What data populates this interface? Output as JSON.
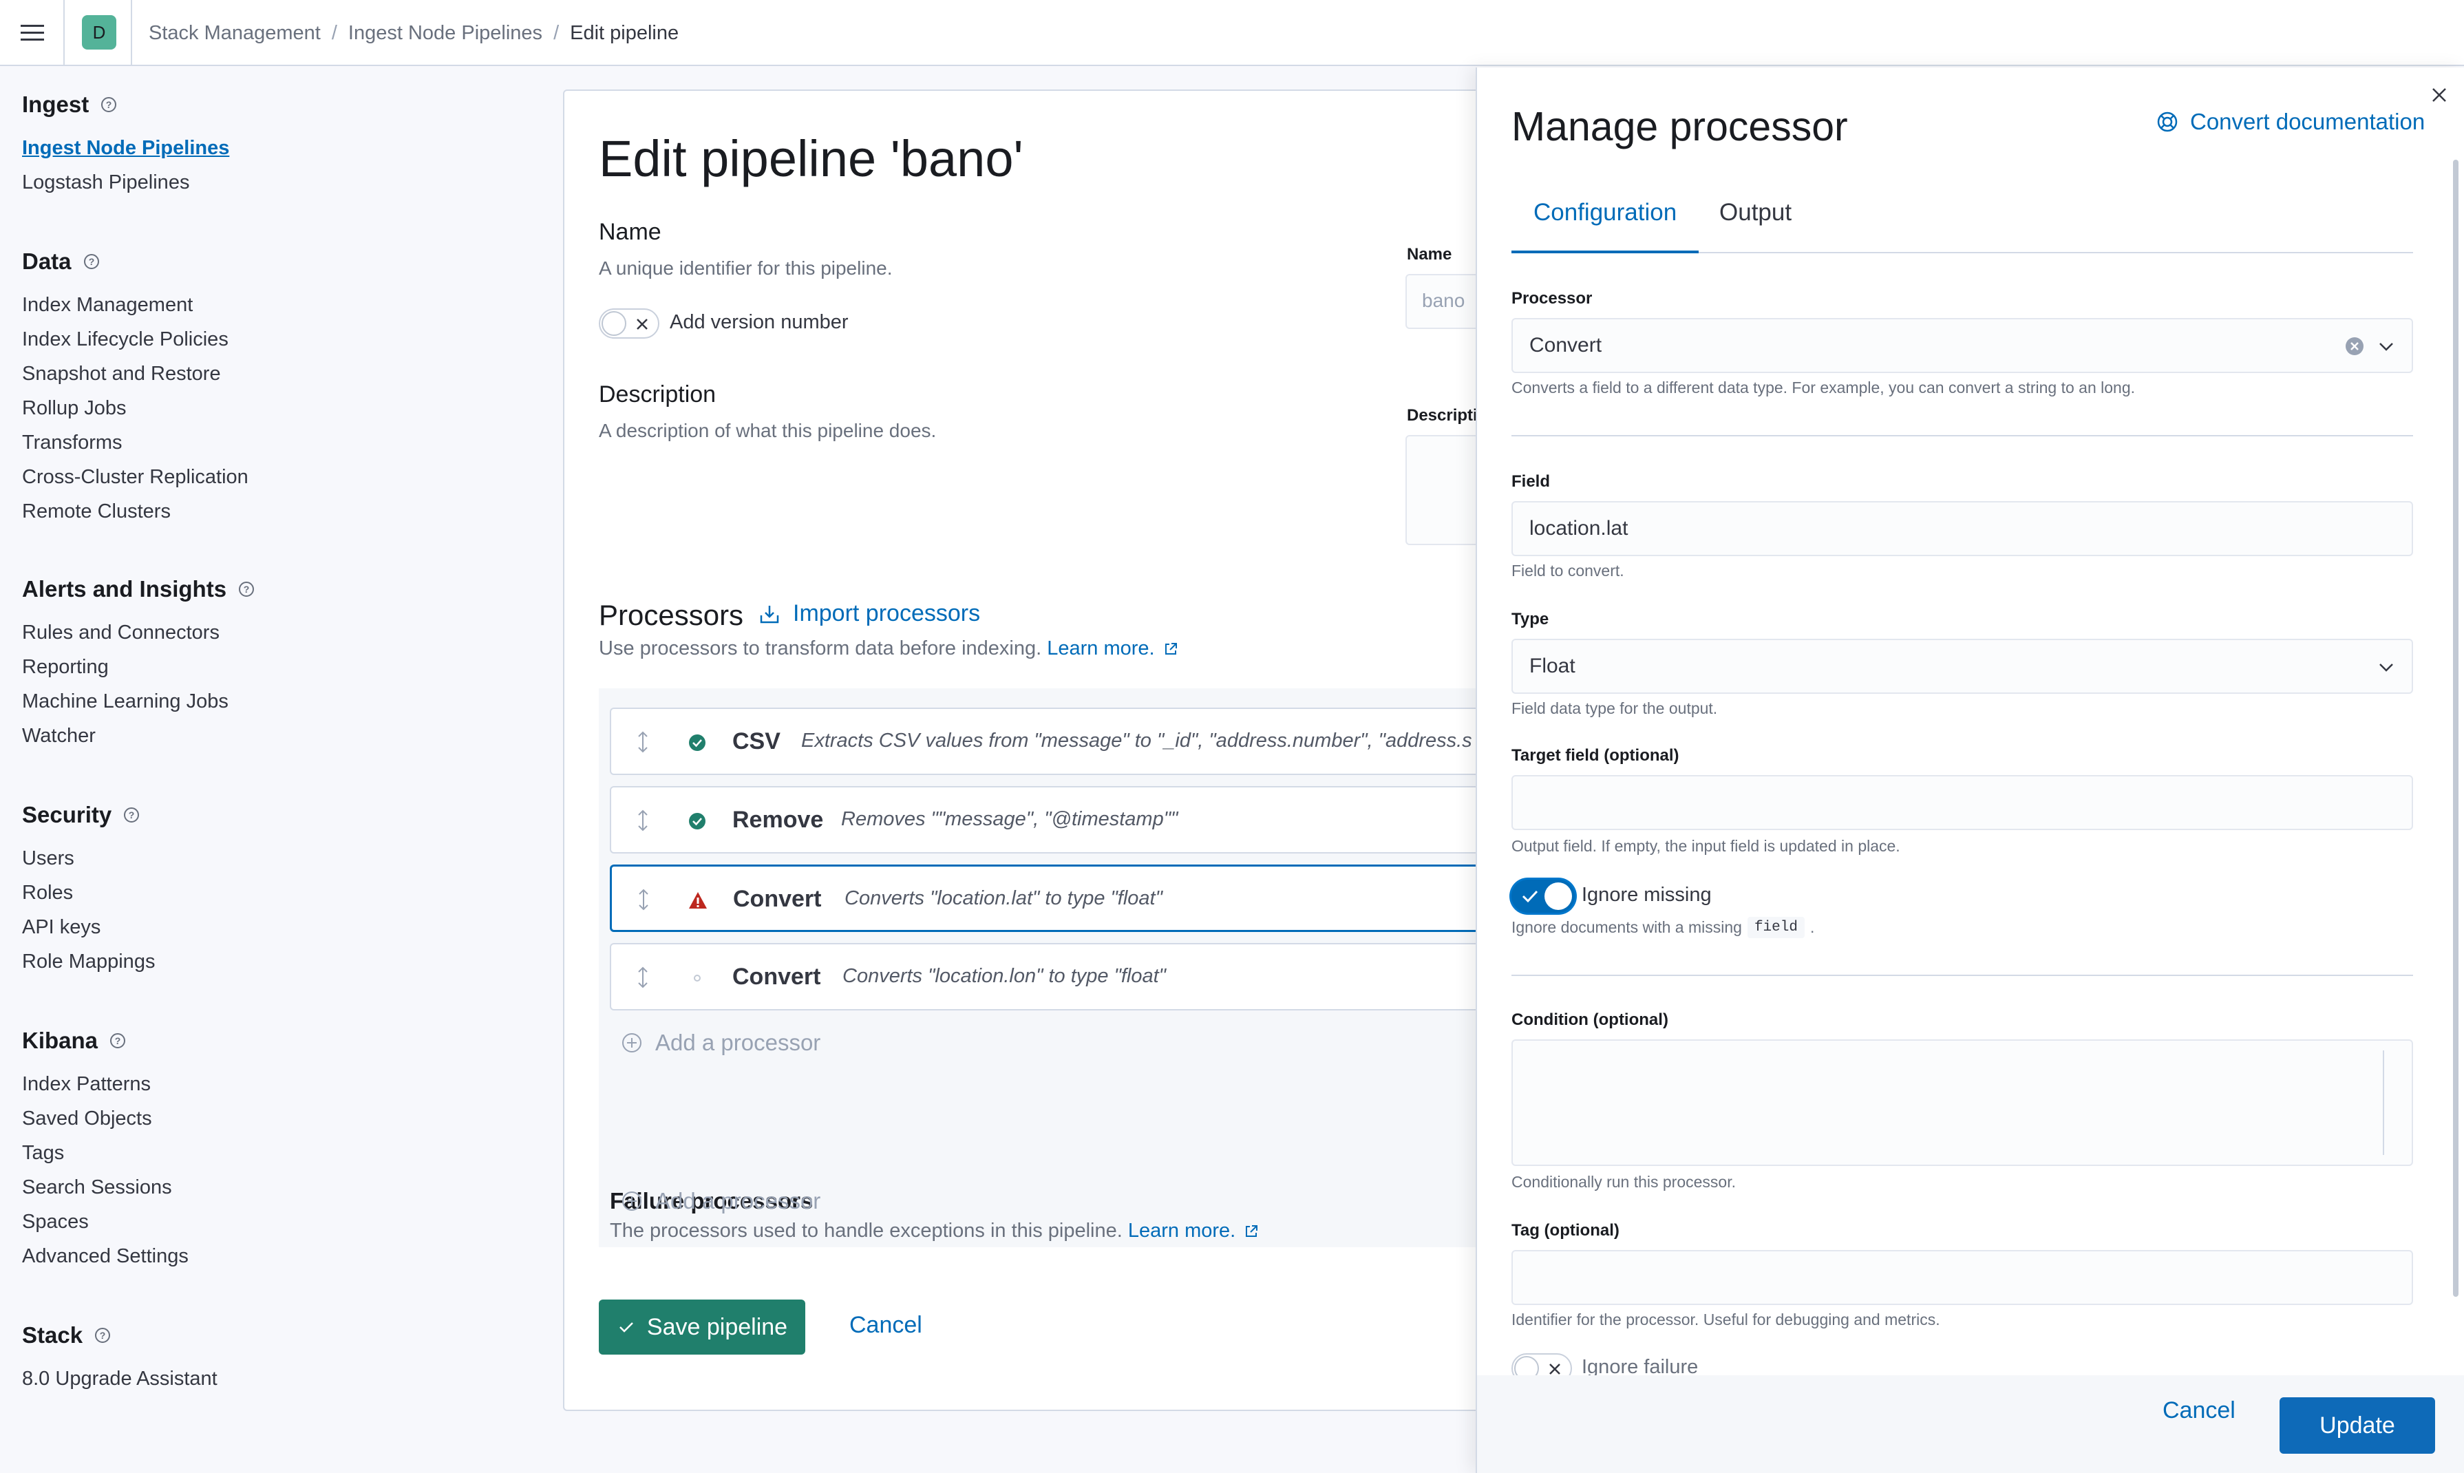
{
  "header": {
    "space_initial": "D",
    "breadcrumbs": [
      "Stack Management",
      "Ingest Node Pipelines",
      "Edit pipeline"
    ],
    "separator": "/"
  },
  "sidebar": {
    "groups": [
      {
        "title": "Ingest",
        "items": [
          "Ingest Node Pipelines",
          "Logstash Pipelines"
        ]
      },
      {
        "title": "Data",
        "items": [
          "Index Management",
          "Index Lifecycle Policies",
          "Snapshot and Restore",
          "Rollup Jobs",
          "Transforms",
          "Cross-Cluster Replication",
          "Remote Clusters"
        ]
      },
      {
        "title": "Alerts and Insights",
        "items": [
          "Rules and Connectors",
          "Reporting",
          "Machine Learning Jobs",
          "Watcher"
        ]
      },
      {
        "title": "Security",
        "items": [
          "Users",
          "Roles",
          "API keys",
          "Role Mappings"
        ]
      },
      {
        "title": "Kibana",
        "items": [
          "Index Patterns",
          "Saved Objects",
          "Tags",
          "Search Sessions",
          "Spaces",
          "Advanced Settings"
        ]
      },
      {
        "title": "Stack",
        "items": [
          "8.0 Upgrade Assistant"
        ]
      }
    ],
    "active_item": "Ingest Node Pipelines"
  },
  "editor": {
    "title": "Edit pipeline 'bano'",
    "name_title": "Name",
    "name_desc": "A unique identifier for this pipeline.",
    "version_toggle_label": "Add version number",
    "name_field_label": "Name",
    "name_field_value": "bano",
    "description_title": "Description",
    "description_desc": "A description of what this pipeline does.",
    "description_field_label": "Descripti",
    "processors_title": "Processors",
    "import_label": "Import processors",
    "processors_desc": "Use processors to transform data before indexing.",
    "learn_more": "Learn more.",
    "processors": [
      {
        "name": "CSV",
        "summary": "Extracts CSV values from \"message\" to \"_id\", \"address.number\", \"address.s",
        "status": "success",
        "status_color": "#207f6c"
      },
      {
        "name": "Remove",
        "summary": "Removes \"\"message\", \"@timestamp\"\"",
        "status": "success",
        "status_color": "#207f6c"
      },
      {
        "name": "Convert",
        "summary": "Converts \"location.lat\" to type \"float\"",
        "status": "warning",
        "status_color": "#bd271e"
      },
      {
        "name": "Convert",
        "summary": "Converts \"location.lon\" to type \"float\"",
        "status": "inactive",
        "status_color": "#c2c9d4"
      }
    ],
    "add_processor": "Add a processor",
    "failure_title": "Failure processors",
    "failure_desc": "The processors used to handle exceptions in this pipeline.",
    "failure_learn_more": "Learn more.",
    "save_label": "Save pipeline",
    "cancel_label": "Cancel"
  },
  "flyout": {
    "title": "Manage processor",
    "doc_link": "Convert documentation",
    "tabs": [
      "Configuration",
      "Output"
    ],
    "active_tab": "Configuration",
    "processor_label": "Processor",
    "processor_value": "Convert",
    "processor_help": "Converts a field to a different data type. For example, you can convert a string to an long.",
    "field_label": "Field",
    "field_value": "location.lat",
    "field_help": "Field to convert.",
    "type_label": "Type",
    "type_value": "Float",
    "type_help": "Field data type for the output.",
    "target_label": "Target field (optional)",
    "target_value": "",
    "target_help": "Output field. If empty, the input field is updated in place.",
    "ignore_missing_label": "Ignore missing",
    "ignore_missing_on": true,
    "ignore_missing_help_pre": "Ignore documents with a missing",
    "ignore_missing_help_code": "field",
    "ignore_missing_help_post": ".",
    "condition_label": "Condition (optional)",
    "condition_help": "Conditionally run this processor.",
    "tag_label": "Tag (optional)",
    "tag_help": "Identifier for the processor. Useful for debugging and metrics.",
    "ignore_failure_label": "Ignore failure",
    "cancel_label": "Cancel",
    "update_label": "Update"
  },
  "colors": {
    "accent": "#006bb8",
    "primary_button": "#0e6ab8",
    "success_button": "#207f6c",
    "danger": "#bd271e"
  }
}
